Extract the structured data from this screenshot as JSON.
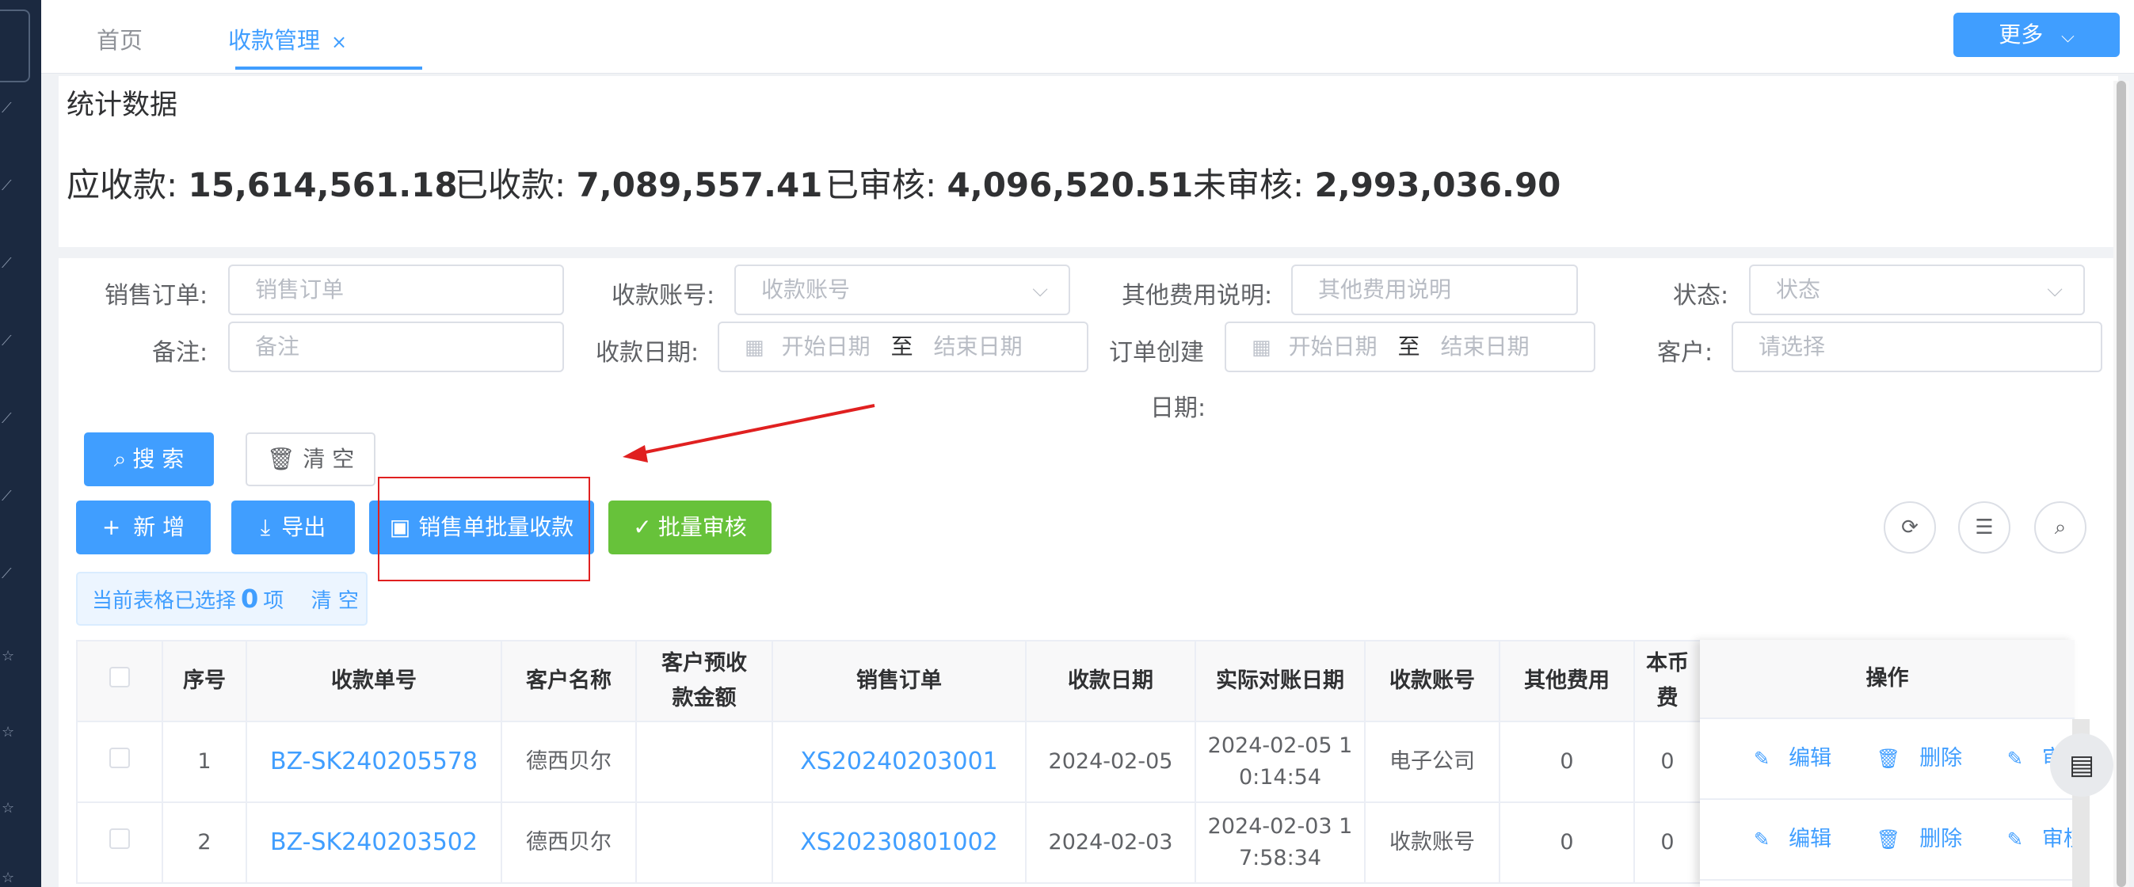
{
  "tabs": [
    {
      "label": "首页"
    },
    {
      "label": "收款管理",
      "close": "×"
    }
  ],
  "header": {
    "more_label": "更多"
  },
  "stats": {
    "title": "统计数据",
    "items": [
      {
        "label": "应收款:",
        "value": "15,614,561.18"
      },
      {
        "label": "已收款:",
        "value": "7,089,557.41"
      },
      {
        "label": "已审核:",
        "value": "4,096,520.51"
      },
      {
        "label": "未审核:",
        "value": "2,993,036.90"
      }
    ]
  },
  "filters": {
    "sales_order": {
      "label": "销售订单:",
      "placeholder": "销售订单"
    },
    "account": {
      "label": "收款账号:",
      "placeholder": "收款账号"
    },
    "other_fee": {
      "label": "其他费用说明:",
      "placeholder": "其他费用说明"
    },
    "status": {
      "label": "状态:",
      "placeholder": "状态"
    },
    "remark": {
      "label": "备注:",
      "placeholder": "备注"
    },
    "pay_date": {
      "label": "收款日期:",
      "start": "开始日期",
      "to": "至",
      "end": "结束日期"
    },
    "order_created": {
      "label_line1": "订单创建",
      "label_line2": "日期:",
      "start": "开始日期",
      "to": "至",
      "end": "结束日期"
    },
    "customer": {
      "label": "客户:",
      "placeholder": "请选择"
    }
  },
  "actions": {
    "search": "搜 索",
    "clear": "清 空",
    "add": "新 增",
    "export": "导出",
    "batch_receive": "销售单批量收款",
    "batch_audit": "批量审核"
  },
  "selection": {
    "prefix": "当前表格已选择",
    "count": "0",
    "suffix": "项",
    "clear": "清 空"
  },
  "table": {
    "headers": {
      "index": "序号",
      "receipt_no": "收款单号",
      "customer": "客户名称",
      "prepay_l1": "客户预收",
      "prepay_l2": "款金额",
      "sales_order": "销售订单",
      "date": "收款日期",
      "actual_date": "实际对账日期",
      "account": "收款账号",
      "other_fee": "其他费用",
      "local_l1": "本币",
      "local_l2": "费",
      "ops": "操作"
    },
    "rows": [
      {
        "index": "1",
        "receipt_no": "BZ-SK240205578",
        "customer": "德西贝尔",
        "prepay": "",
        "sales_order": "XS20240203001",
        "date": "2024-02-05",
        "actual_l1": "2024-02-05 1",
        "actual_l2": "0:14:54",
        "account": "电子公司",
        "other_fee": "0",
        "local": "0"
      },
      {
        "index": "2",
        "receipt_no": "BZ-SK240203502",
        "customer": "德西贝尔",
        "prepay": "",
        "sales_order": "XS20230801002",
        "date": "2024-02-03",
        "actual_l1": "2024-02-03 1",
        "actual_l2": "7:58:34",
        "account": "收款账号",
        "other_fee": "0",
        "local": "0"
      }
    ],
    "ops": {
      "edit": "编辑",
      "delete": "删除",
      "audit": "审核"
    }
  },
  "colors": {
    "primary": "#409eff",
    "success": "#67c23a",
    "annotation": "#e02020"
  }
}
